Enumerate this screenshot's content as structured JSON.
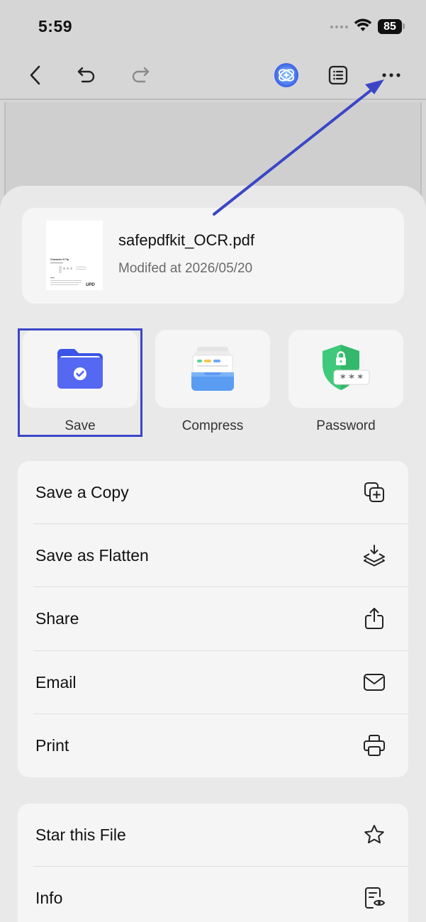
{
  "status": {
    "time": "5:59",
    "battery": "85"
  },
  "toolbar": {
    "icons": [
      "back-icon",
      "undo-icon",
      "redo-icon",
      "ai-assistant-icon",
      "outline-icon",
      "more-icon"
    ]
  },
  "file": {
    "name": "safepdfkit_OCR.pdf",
    "modified": "Modifed at 2026/05/20",
    "thumb_title": "Character N Tip",
    "thumb_logo": "UPD"
  },
  "actions": [
    {
      "label": "Save",
      "icon": "folder-check-icon"
    },
    {
      "label": "Compress",
      "icon": "compress-tray-icon"
    },
    {
      "label": "Password",
      "icon": "shield-lock-icon"
    }
  ],
  "menu": [
    {
      "label": "Save a Copy",
      "icon": "copy-plus-icon"
    },
    {
      "label": "Save as Flatten",
      "icon": "flatten-layers-icon"
    },
    {
      "label": "Share",
      "icon": "share-icon"
    },
    {
      "label": "Email",
      "icon": "mail-icon"
    },
    {
      "label": "Print",
      "icon": "printer-icon"
    }
  ],
  "menu2": [
    {
      "label": "Star this File",
      "icon": "star-icon"
    },
    {
      "label": "Info",
      "icon": "info-doc-icon"
    }
  ],
  "colors": {
    "annotation": "#3b46c7",
    "folder": "#4f63f0",
    "shield": "#3fc97a"
  }
}
